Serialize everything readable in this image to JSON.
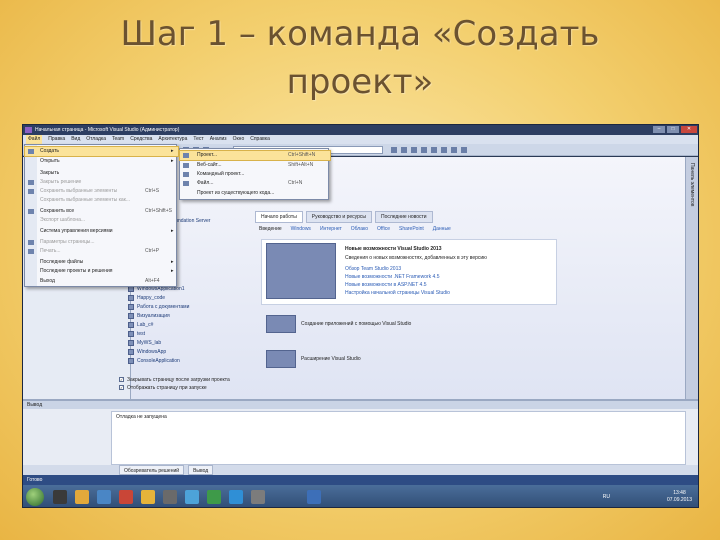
{
  "slide": {
    "title_line1": "Шаг 1 – команда «Создать",
    "title_line2": "проект»"
  },
  "window": {
    "title": "Начальная страница - Microsoft Visual Studio (Администратор)",
    "controls": [
      "–",
      "□",
      "✕"
    ]
  },
  "menubar": {
    "items": [
      "Файл",
      "Правка",
      "Вид",
      "Отладка",
      "Team",
      "Средства",
      "Архитектура",
      "Тест",
      "Анализ",
      "Окно",
      "Справка"
    ]
  },
  "file_menu": {
    "items": [
      {
        "label": "Создать",
        "shortcut": "",
        "arrow": "▸",
        "state": "highlight"
      },
      {
        "label": "Открыть",
        "shortcut": "",
        "arrow": "▸",
        "state": "normal"
      },
      {
        "label": "Закрыть",
        "shortcut": "",
        "arrow": "",
        "state": "normal"
      },
      {
        "label": "Закрыть решение",
        "shortcut": "",
        "arrow": "",
        "state": "dim"
      },
      {
        "label": "Сохранить выбранные элементы",
        "shortcut": "Ctrl+S",
        "arrow": "",
        "state": "dim"
      },
      {
        "label": "Сохранить выбранные элементы как...",
        "shortcut": "",
        "arrow": "",
        "state": "dim"
      },
      {
        "label": "Сохранить все",
        "shortcut": "Ctrl+Shift+S",
        "arrow": "",
        "state": "normal"
      },
      {
        "label": "Экспорт шаблона...",
        "shortcut": "",
        "arrow": "",
        "state": "dim"
      },
      {
        "label": "Система управления версиями",
        "shortcut": "",
        "arrow": "▸",
        "state": "normal"
      },
      {
        "label": "Параметры страницы...",
        "shortcut": "",
        "arrow": "",
        "state": "dim"
      },
      {
        "label": "Печать...",
        "shortcut": "Ctrl+P",
        "arrow": "",
        "state": "dim"
      },
      {
        "label": "Последние файлы",
        "shortcut": "",
        "arrow": "▸",
        "state": "normal"
      },
      {
        "label": "Последние проекты и решения",
        "shortcut": "",
        "arrow": "▸",
        "state": "normal"
      },
      {
        "label": "Выход",
        "shortcut": "Alt+F4",
        "arrow": "",
        "state": "normal"
      }
    ]
  },
  "create_submenu": {
    "items": [
      {
        "label": "Проект...",
        "shortcut": "Ctrl+Shift+N",
        "state": "highlight"
      },
      {
        "label": "Веб-сайт...",
        "shortcut": "Shift+Alt+N",
        "state": "normal"
      },
      {
        "label": "Командный проект...",
        "shortcut": "",
        "state": "normal"
      },
      {
        "label": "Файл...",
        "shortcut": "Ctrl+N",
        "state": "normal"
      },
      {
        "label": "Проект из существующего кода...",
        "shortcut": "",
        "state": "normal"
      }
    ]
  },
  "recent_projects": {
    "items": [
      "Сервер Team Foundation Server",
      "WindowsApplication1",
      "Happy_code",
      "Работа с документами",
      "Визуализация",
      "Lab_c#",
      "test",
      "MyWS_lab",
      "WindowsApp",
      "ConsoleApplication"
    ],
    "checkbox_close": "Закрывать страницу после загрузки проекта",
    "checkbox_show": "Отображать страницу при запуске"
  },
  "start_page": {
    "tabs": [
      "Начало работы",
      "Руководство и ресурсы",
      "Последние новости"
    ],
    "subtabs": [
      "Введение",
      "Windows",
      "Интернет",
      "Облако",
      "Office",
      "SharePoint",
      "Данные"
    ],
    "card1_title": "Новые возможности Visual Studio 2013",
    "card1_lines": [
      "Сведения о новых возможностях, добавленных в эту версию",
      "Обзор Team Studio 2013",
      "Новые возможности .NET Framework 4.5",
      "Новые возможности в ASP.NET 4.5",
      "Настройка начальной страницы Visual Studio"
    ],
    "card2_title": "Создание приложений с помощью Visual Studio",
    "card3_title": "Расширение Visual Studio"
  },
  "right_strip": {
    "label": "Панель элементов"
  },
  "output": {
    "header": "Вывод",
    "text": "Отладка не запущена"
  },
  "bottom_tabs": [
    "Обозреватель решений",
    "Вывод"
  ],
  "status": {
    "text": "Готово"
  },
  "taskbar": {
    "language": "RU",
    "time": "13:48",
    "date": "07.09.2013",
    "icon_colors": [
      "#3a3a3a",
      "#e2a93b",
      "#4a86c5",
      "#c94637",
      "#e6b43a",
      "#6a6a6a",
      "#4da3d9",
      "#3e9a49",
      "#2f8fd6",
      "#7c7c7c",
      "#3d6fb8"
    ]
  }
}
